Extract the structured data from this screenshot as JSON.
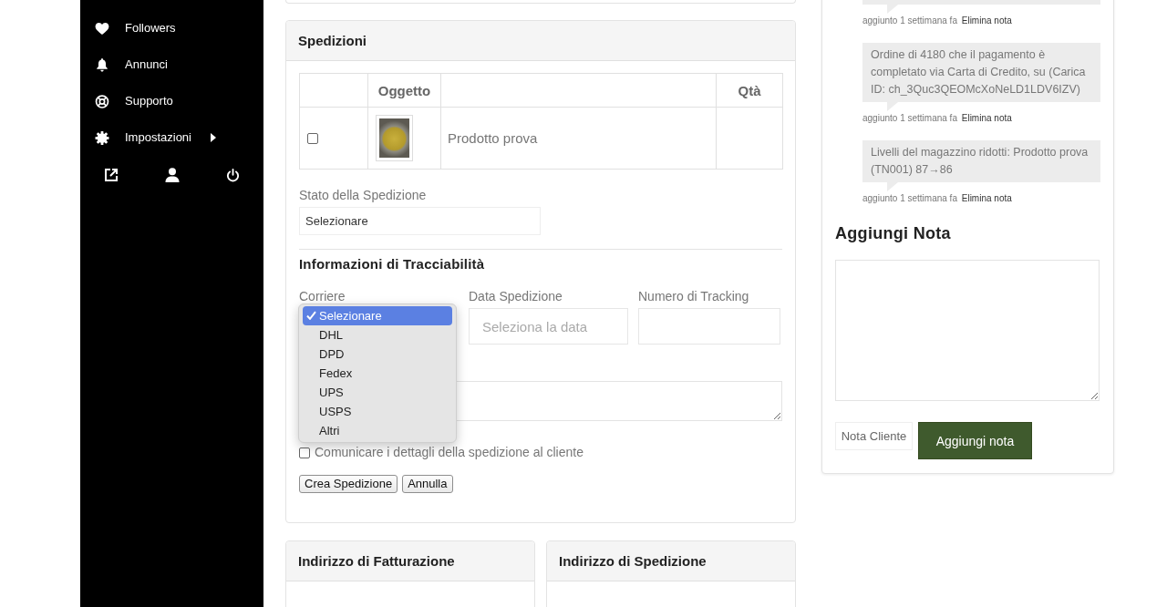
{
  "sidebar": {
    "items": [
      {
        "label": "Followers",
        "submenu": false
      },
      {
        "label": "Annunci",
        "submenu": false
      },
      {
        "label": "Supporto",
        "submenu": false
      },
      {
        "label": "Impostazioni",
        "submenu": true
      }
    ]
  },
  "shipments": {
    "title": "Spedizioni",
    "table": {
      "item_heading": "Oggetto",
      "qty_heading": "Qtà",
      "rows": [
        {
          "checked": false,
          "product": "Prodotto prova"
        }
      ]
    },
    "status": {
      "label": "Stato della Spedizione",
      "value": "Selezionare"
    },
    "tracking": {
      "title": "Informazioni di Tracciabilità",
      "carrier": {
        "label": "Corriere",
        "expanded": true,
        "options": [
          {
            "label": "Selezionare",
            "selected": true
          },
          {
            "label": "DHL",
            "selected": false
          },
          {
            "label": "DPD",
            "selected": false
          },
          {
            "label": "Fedex",
            "selected": false
          },
          {
            "label": "UPS",
            "selected": false
          },
          {
            "label": "USPS",
            "selected": false
          },
          {
            "label": "Altri",
            "selected": false
          }
        ]
      },
      "ship_date": {
        "label": "Data Spedizione",
        "placeholder": "Seleziona la data"
      },
      "tracking_number": {
        "label": "Numero di Tracking"
      }
    },
    "notify_customer": {
      "label": "Comunicare i dettagli della spedizione al cliente",
      "checked": false
    },
    "buttons": [
      {
        "label": "Crea Spedizione"
      },
      {
        "label": "Annulla"
      }
    ]
  },
  "address_cards": [
    {
      "title": "Indirizzo di Fatturazione"
    },
    {
      "title": "Indirizzo di Spedizione"
    }
  ],
  "notes": {
    "items": [
      {
        "added": "aggiunto 1 settimana fa",
        "delete_label": "Elimina nota"
      },
      {
        "text": "Ordine di 4180 che il pagamento è completato via Carta di Credito, su (Carica ID: ch_3Quc3QEOMcXoNeLD1LDV6IZV)",
        "added": "aggiunto 1 settimana fa",
        "delete_label": "Elimina nota"
      },
      {
        "text": "Livelli del magazzino ridotti: Prodotto prova (TN001) 87→86",
        "added": "aggiunto 1 settimana fa",
        "delete_label": "Elimina nota"
      }
    ]
  },
  "add_note": {
    "title": "Aggiungi Nota",
    "note_type": "Nota Cliente",
    "submit": "Aggiungi nota"
  }
}
